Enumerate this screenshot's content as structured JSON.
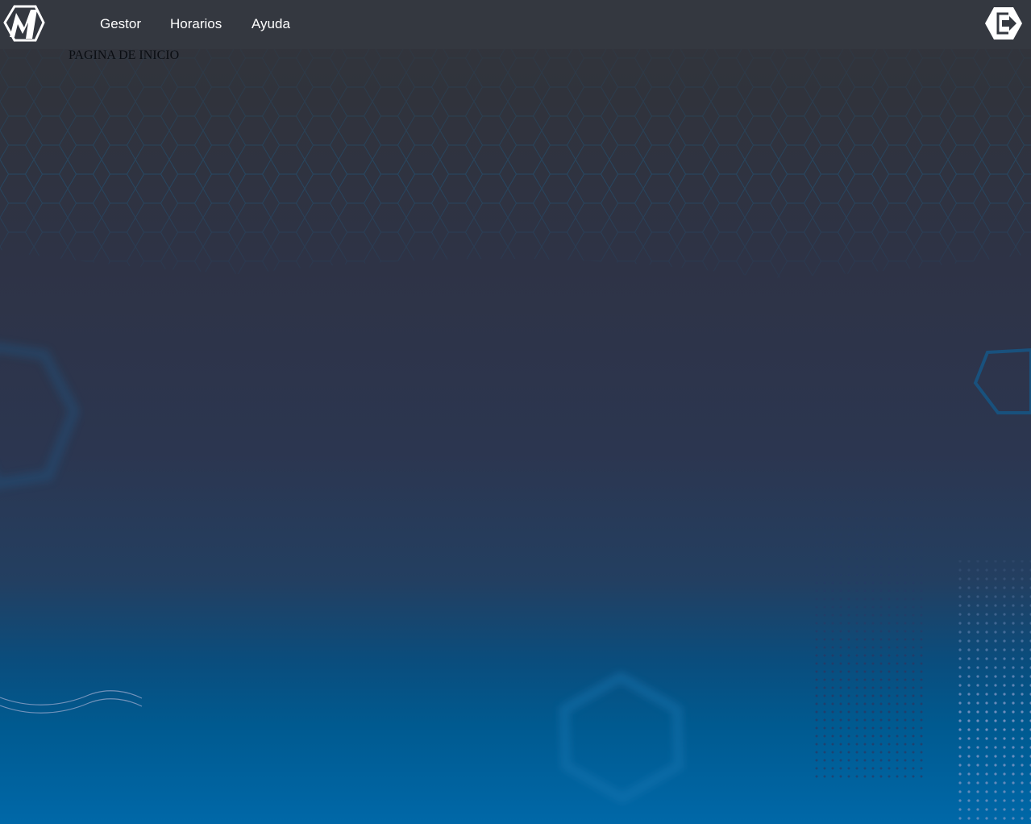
{
  "nav": {
    "logo_icon": "m-logo-icon",
    "links": [
      {
        "label": "Gestor"
      },
      {
        "label": "Horarios"
      },
      {
        "label": "Ayuda"
      }
    ],
    "logout_icon": "logout-icon"
  },
  "page": {
    "heading": "PAGINA DE INICIO"
  },
  "colors": {
    "navbar": "#343840",
    "background_top": "#33363d",
    "background_bottom": "#0068a8",
    "hexagon_accent": "#1e6fa3"
  }
}
